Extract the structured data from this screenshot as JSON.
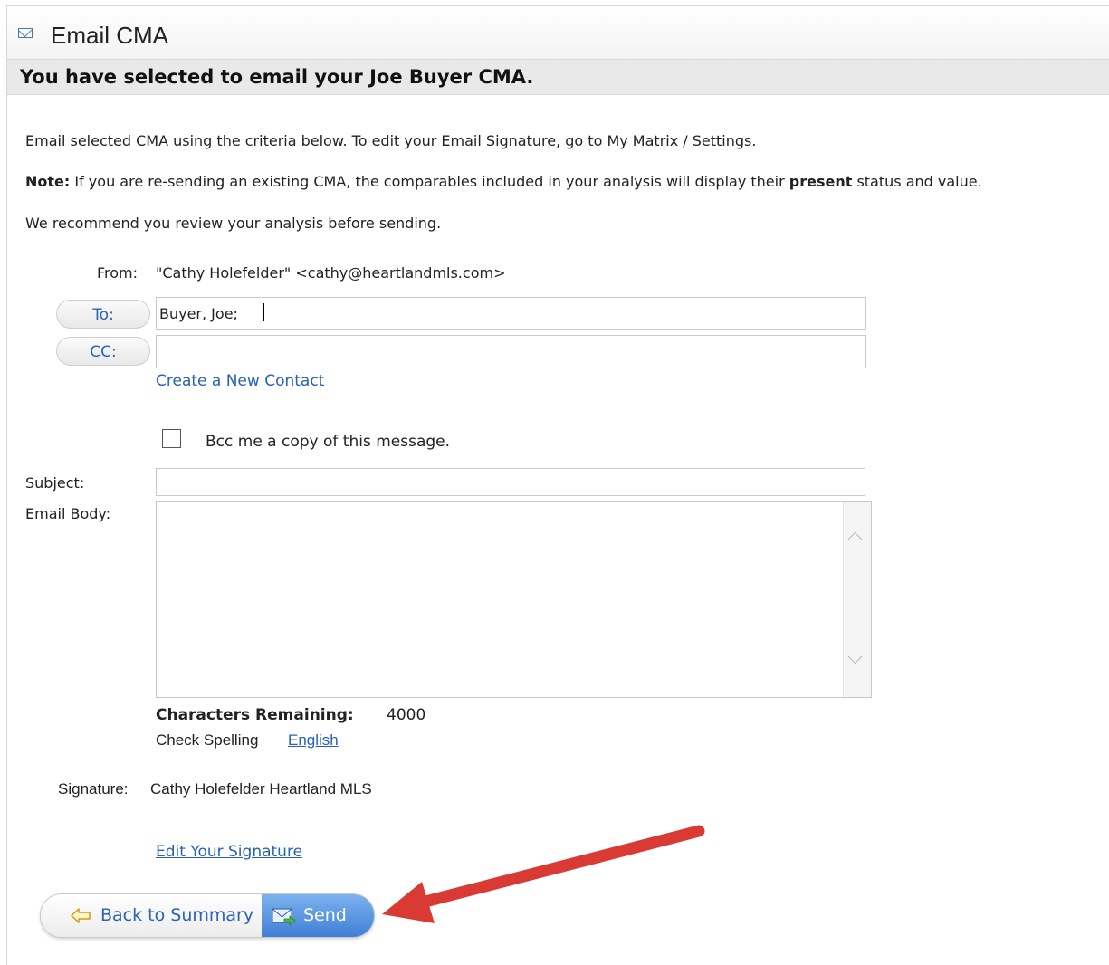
{
  "window": {
    "title": "Email CMA"
  },
  "header": {
    "subtitle": "You have selected to email your Joe Buyer CMA."
  },
  "intro": {
    "line1": "Email selected CMA using the criteria below. To edit your Email Signature, go to My Matrix / Settings.",
    "note_label": "Note:",
    "note_text_a": " If you are re-sending an existing CMA, the comparables included in your analysis will display their ",
    "note_bold": "present",
    "note_text_b": " status and value.",
    "recommend": "We recommend you review your analysis before sending."
  },
  "form": {
    "from_label": "From:",
    "from_value": "\"Cathy Holefelder\" <cathy@heartlandmls.com>",
    "to_button": "To:",
    "to_value": "Buyer, Joe;",
    "cc_button": "CC:",
    "cc_value": "",
    "create_contact": "Create a New Contact",
    "bcc_label": "Bcc me a copy of this message.",
    "bcc_checked": false,
    "subject_label": "Subject:",
    "subject_value": "",
    "body_label": "Email Body:",
    "body_value": "",
    "chars_label": "Characters Remaining:",
    "chars_value": "4000",
    "spell_label": "Check Spelling",
    "spell_lang": "English",
    "signature_label": "Signature:",
    "signature_value": "Cathy Holefelder Heartland MLS",
    "edit_signature": "Edit Your Signature"
  },
  "buttons": {
    "back": "Back to Summary",
    "send": "Send"
  },
  "icons": {
    "title": "envelope-icon",
    "back": "arrow-left-icon",
    "send": "mail-send-icon",
    "annotation": "red-arrow"
  },
  "colors": {
    "link": "#2561b6",
    "send_bg": "#3f7fd6",
    "annotation_arrow": "#e03c35"
  }
}
